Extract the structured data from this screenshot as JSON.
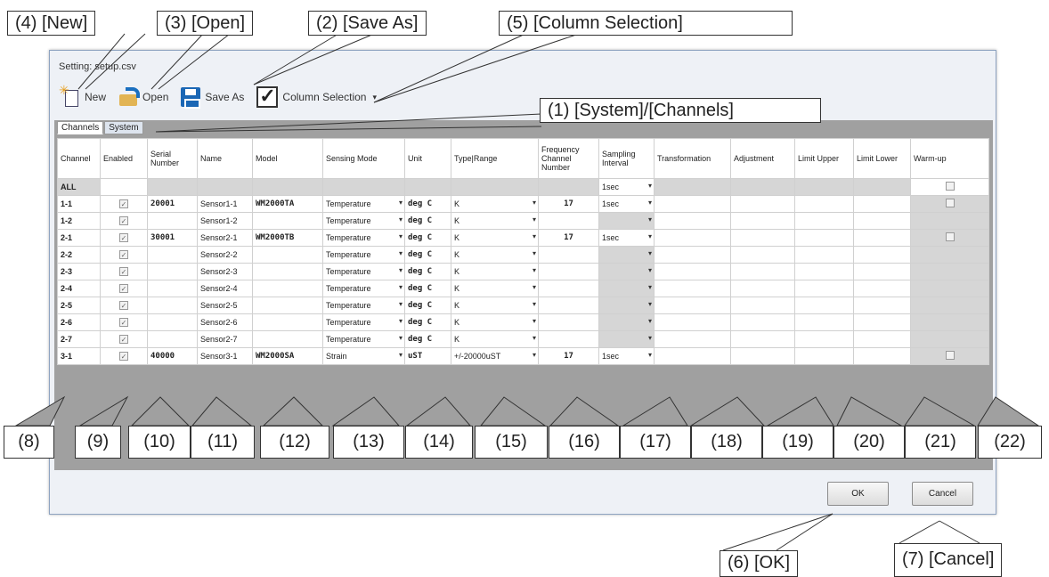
{
  "window": {
    "title": "Setting: setup.csv",
    "toolbar": {
      "new": "New",
      "open": "Open",
      "save_as": "Save As",
      "column_selection": "Column Selection"
    },
    "tabs": [
      "Channels",
      "System"
    ],
    "buttons": {
      "ok": "OK",
      "cancel": "Cancel"
    }
  },
  "callouts": {
    "new": "(4) [New]",
    "open": "(3) [Open]",
    "save_as": "(2) [Save As]",
    "column_selection": "(5) [Column Selection]",
    "system_channels": "(1) [System]/[Channels]",
    "ok": "(6) [OK]",
    "cancel": "(7) [Cancel]"
  },
  "column_numbers": [
    "(8)",
    "(9)",
    "(10)",
    "(11)",
    "(12)",
    "(13)",
    "(14)",
    "(15)",
    "(16)",
    "(17)",
    "(18)",
    "(19)",
    "(20)",
    "(21)",
    "(22)"
  ],
  "table": {
    "headers": [
      "Channel",
      "Enabled",
      "Serial Number",
      "Name",
      "Model",
      "Sensing Mode",
      "Unit",
      "Type|Range",
      "Frequency Channel Number",
      "Sampling Interval",
      "Transformation",
      "Adjustment",
      "Limit Upper",
      "Limit Lower",
      "Warm-up"
    ],
    "rows": [
      [
        "ALL",
        "",
        "",
        "",
        "",
        "",
        "",
        "",
        "",
        "1sec",
        "",
        "",
        "",
        "",
        ""
      ],
      [
        "1-1",
        "",
        "20001",
        "Sensor1-1",
        "WM2000TA",
        "Temperature",
        "deg C",
        "K",
        "17",
        "1sec",
        "",
        "",
        "",
        "",
        ""
      ],
      [
        "1-2",
        "",
        "",
        "Sensor1-2",
        "",
        "Temperature",
        "deg C",
        "K",
        "",
        "",
        "",
        "",
        "",
        "",
        ""
      ],
      [
        "2-1",
        "",
        "30001",
        "Sensor2-1",
        "WM2000TB",
        "Temperature",
        "deg C",
        "K",
        "17",
        "1sec",
        "",
        "",
        "",
        "",
        ""
      ],
      [
        "2-2",
        "",
        "",
        "Sensor2-2",
        "",
        "Temperature",
        "deg C",
        "K",
        "",
        "",
        "",
        "",
        "",
        "",
        ""
      ],
      [
        "2-3",
        "",
        "",
        "Sensor2-3",
        "",
        "Temperature",
        "deg C",
        "K",
        "",
        "",
        "",
        "",
        "",
        "",
        ""
      ],
      [
        "2-4",
        "",
        "",
        "Sensor2-4",
        "",
        "Temperature",
        "deg C",
        "K",
        "",
        "",
        "",
        "",
        "",
        "",
        ""
      ],
      [
        "2-5",
        "",
        "",
        "Sensor2-5",
        "",
        "Temperature",
        "deg C",
        "K",
        "",
        "",
        "",
        "",
        "",
        "",
        ""
      ],
      [
        "2-6",
        "",
        "",
        "Sensor2-6",
        "",
        "Temperature",
        "deg C",
        "K",
        "",
        "",
        "",
        "",
        "",
        "",
        ""
      ],
      [
        "2-7",
        "",
        "",
        "Sensor2-7",
        "",
        "Temperature",
        "deg C",
        "K",
        "",
        "",
        "",
        "",
        "",
        "",
        ""
      ],
      [
        "3-1",
        "",
        "40000",
        "Sensor3-1",
        "WM2000SA",
        "Strain",
        "uST",
        "+/-20000uST",
        "17",
        "1sec",
        "",
        "",
        "",
        "",
        ""
      ]
    ]
  }
}
